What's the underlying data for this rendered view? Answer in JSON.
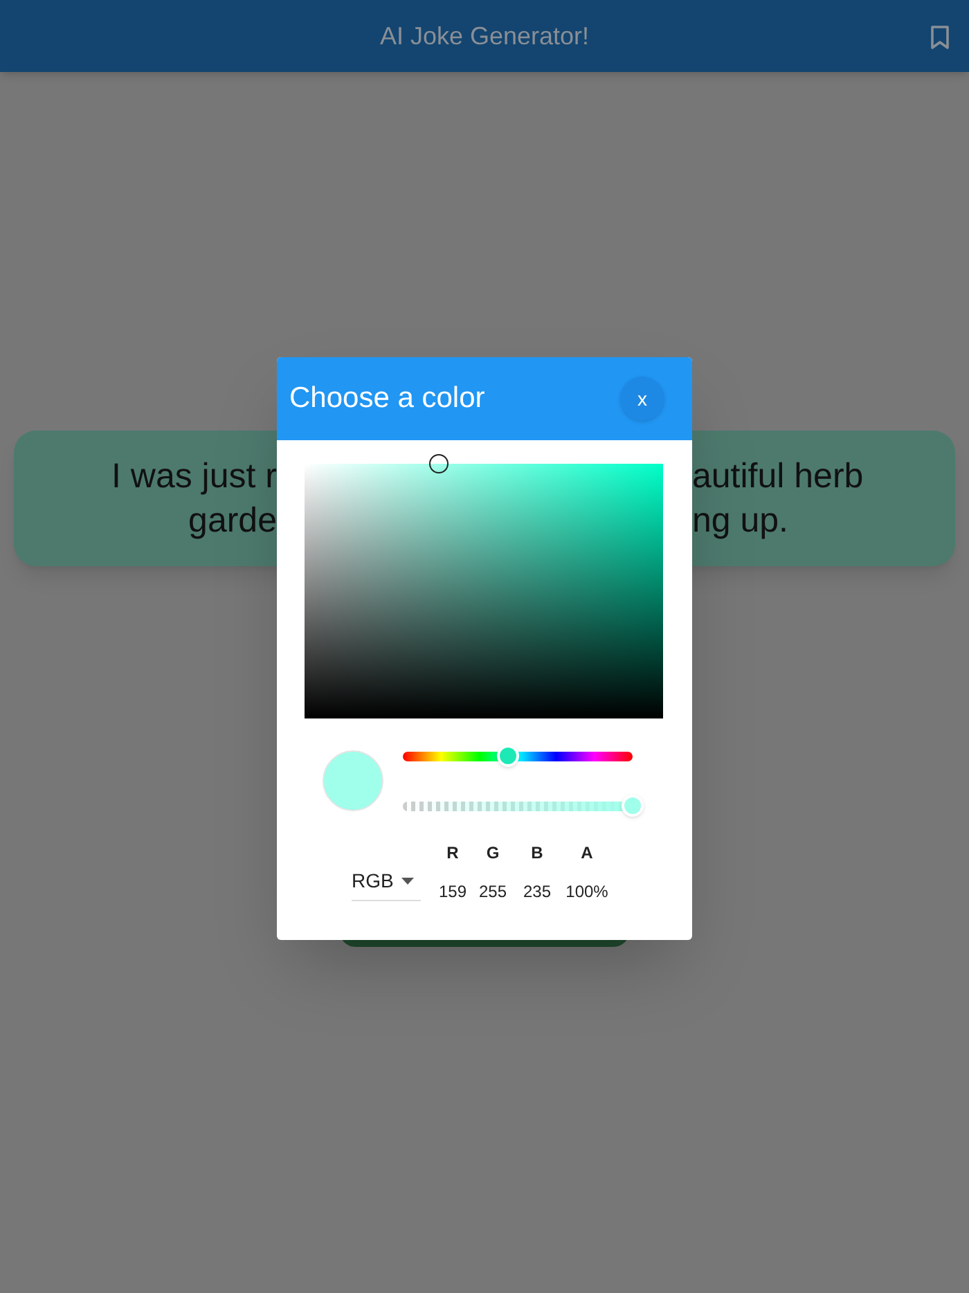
{
  "app_bar": {
    "title": "AI Joke Generator!"
  },
  "joke_card": {
    "left_lines": [
      "I was just r",
      "garde"
    ],
    "right_lines": [
      "autiful herb",
      "ng up."
    ]
  },
  "dialog": {
    "title": "Choose a color",
    "close_label": "x",
    "hue": {
      "level": 0.46
    },
    "alpha": {
      "level": 1
    },
    "mode": {
      "value": "RGB"
    },
    "channels": [
      {
        "label": "R",
        "value": "159"
      },
      {
        "label": "G",
        "value": "255"
      },
      {
        "label": "B",
        "value": "235"
      },
      {
        "label": "A",
        "value": "100%"
      }
    ]
  }
}
